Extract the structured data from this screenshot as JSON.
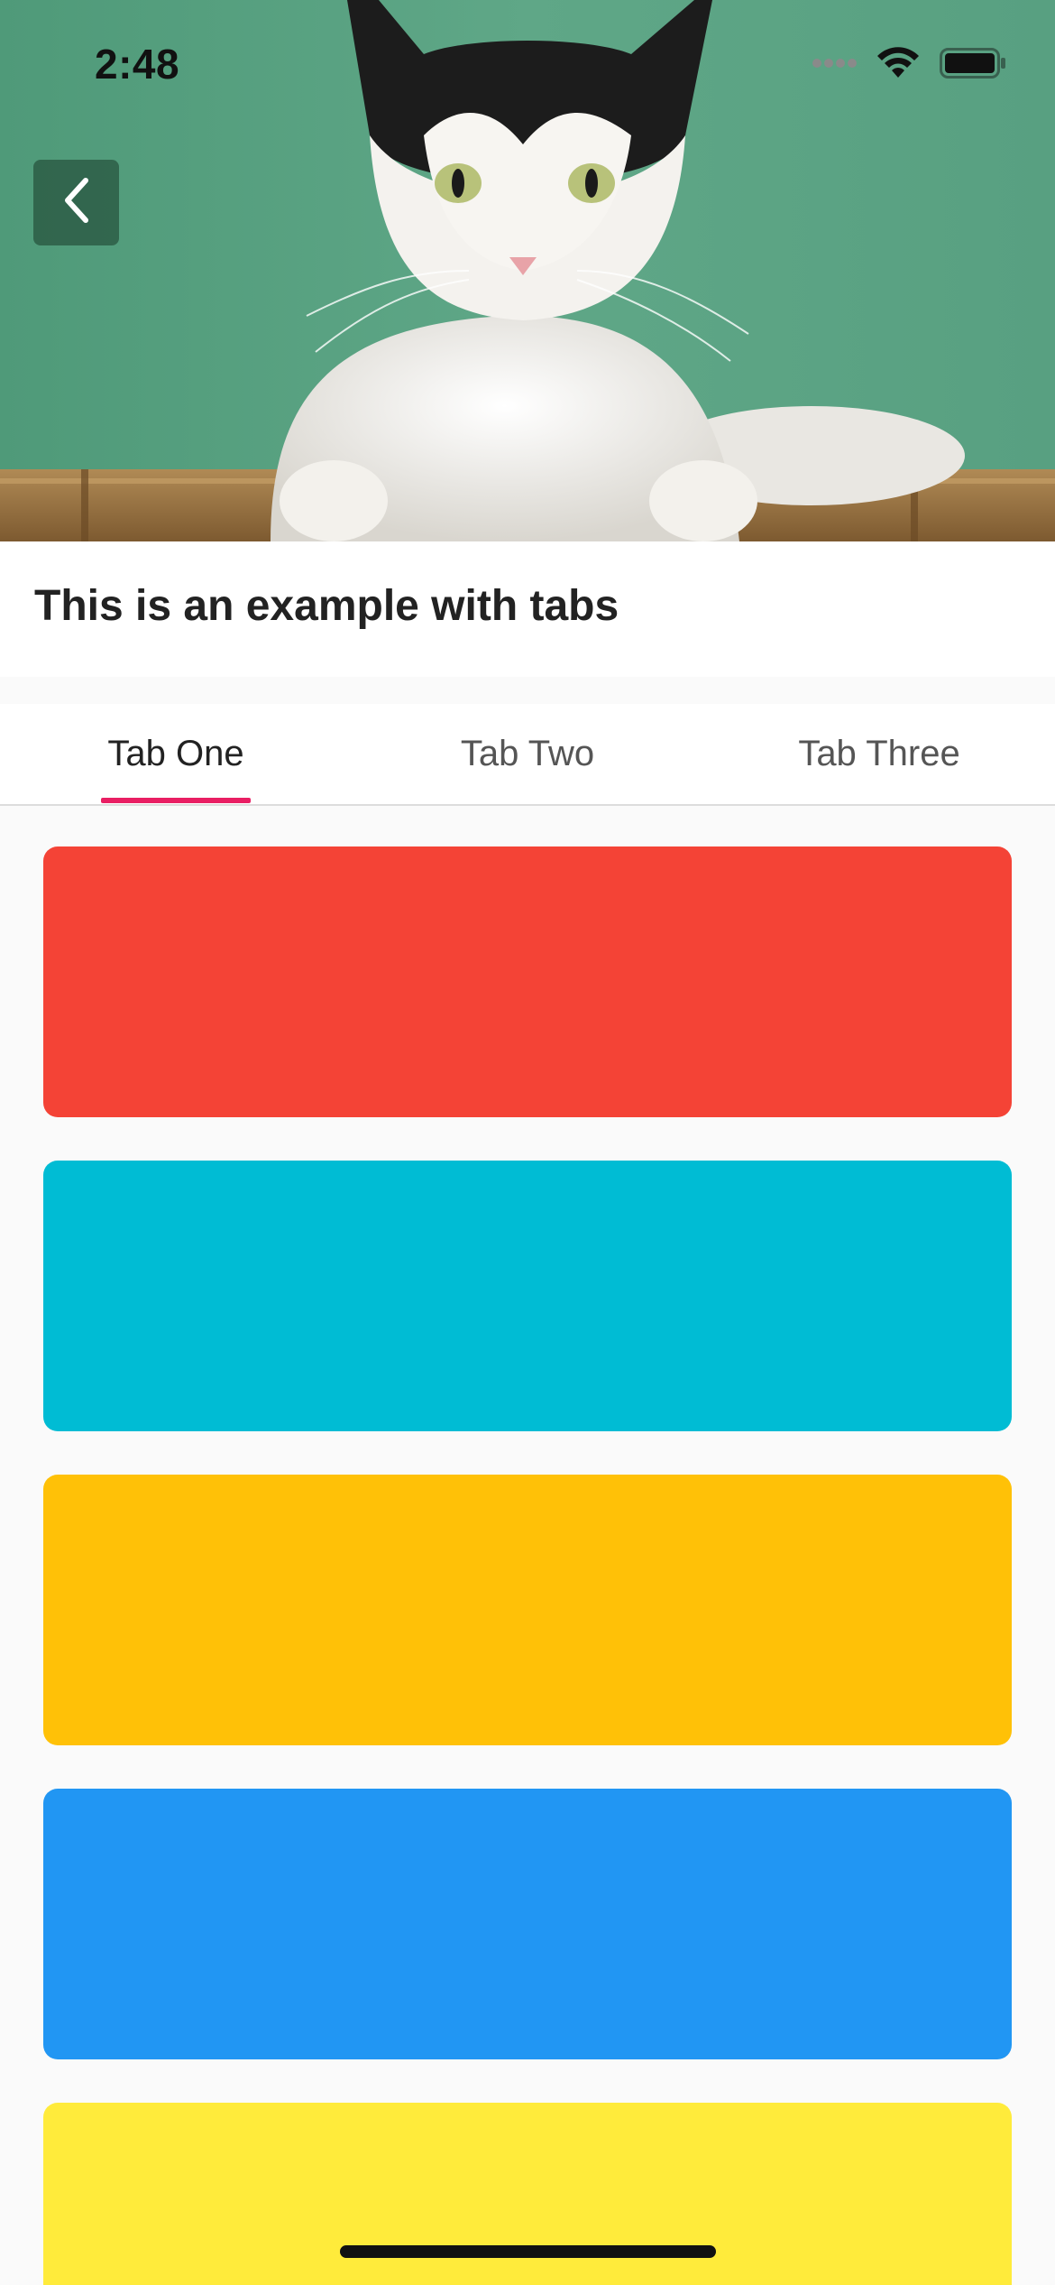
{
  "status_bar": {
    "time": "2:48",
    "icons": [
      "signal-icon",
      "wifi-icon",
      "battery-icon"
    ]
  },
  "hero": {
    "image_subject": "cat",
    "back_icon": "chevron-left-icon"
  },
  "title": "This is an example with tabs",
  "tabs": [
    {
      "label": "Tab One",
      "active": true
    },
    {
      "label": "Tab Two",
      "active": false
    },
    {
      "label": "Tab Three",
      "active": false
    }
  ],
  "colors": {
    "tab_indicator": "#e91e63",
    "cards": [
      "#f44336",
      "#00bcd4",
      "#ffc107",
      "#2196f3",
      "#ffeb3b"
    ]
  }
}
